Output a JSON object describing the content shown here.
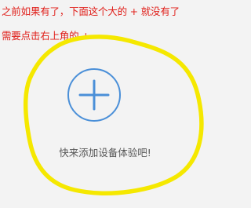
{
  "annotation": {
    "line1": "之前如果有了，下面这个大的 + 就没有了",
    "line2": "需要点击右上角的 +",
    "color": "#e0201b"
  },
  "highlight": {
    "shape": "hand-drawn-circle",
    "color": "#f5e800"
  },
  "main": {
    "add_button": {
      "icon": "plus-icon",
      "color": "#4a8fd8"
    },
    "empty_hint": "快来添加设备体验吧!"
  }
}
